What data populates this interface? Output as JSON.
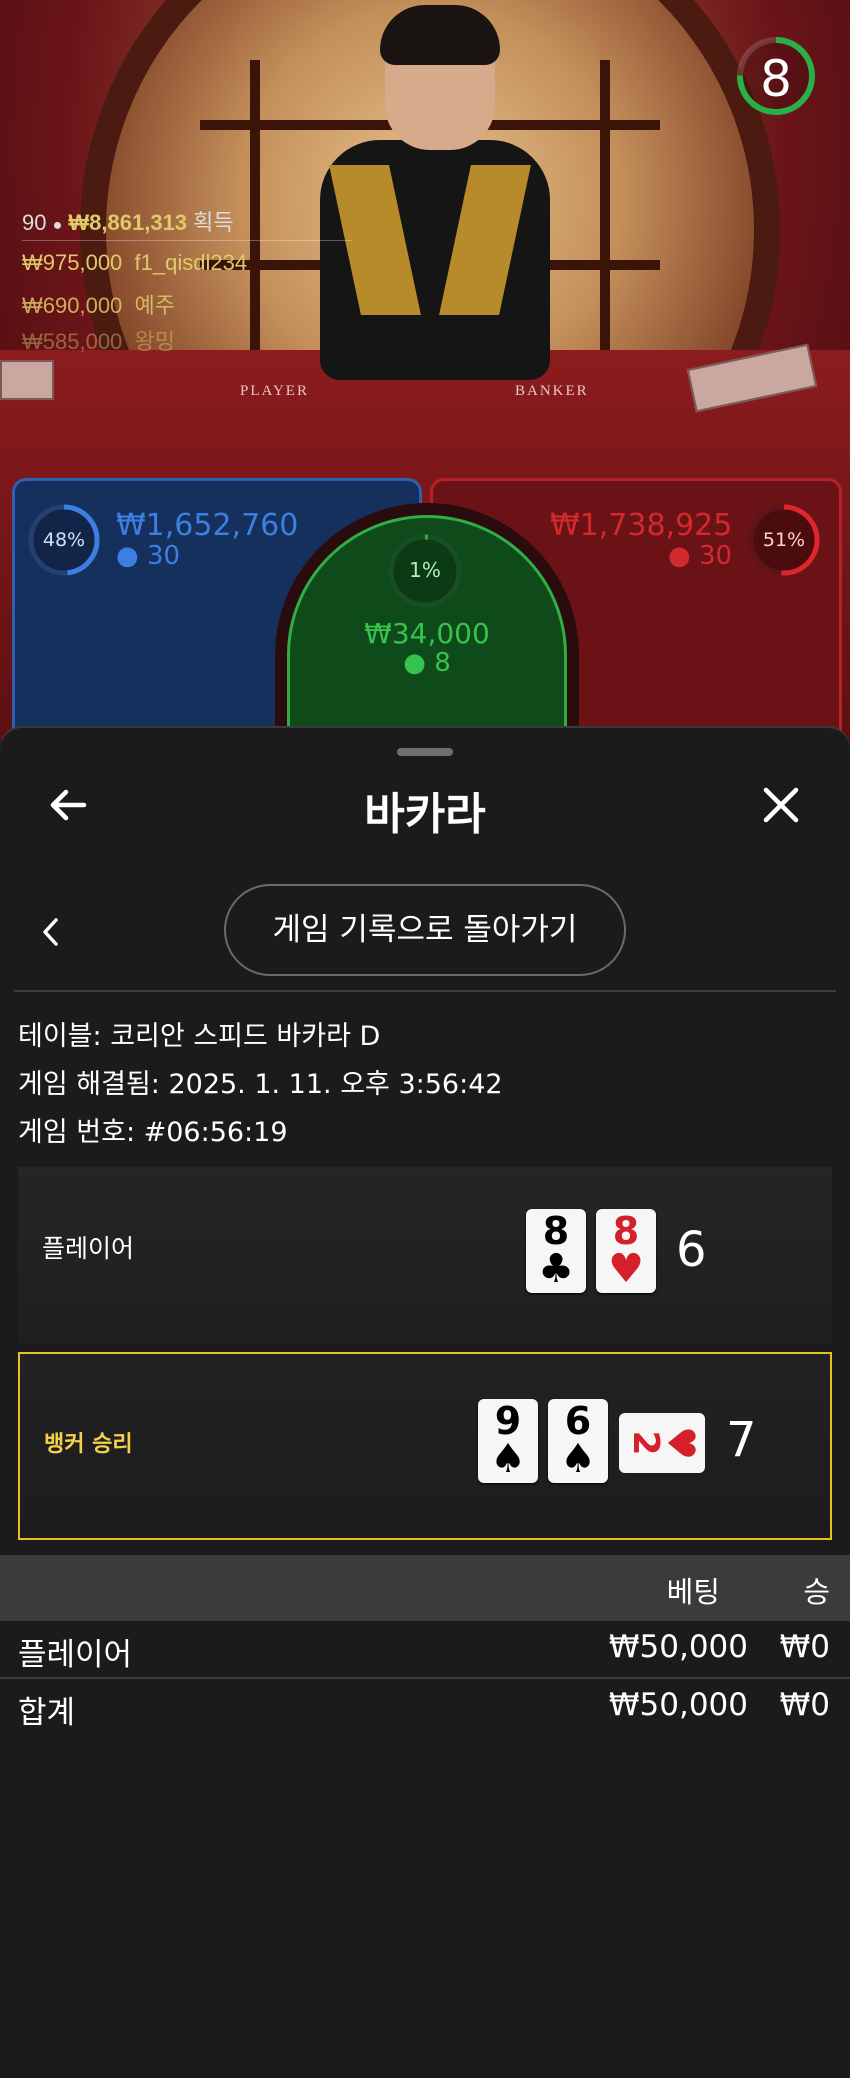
{
  "timer": {
    "value": "8"
  },
  "leaderboard": {
    "players_count": "90",
    "total_win": "₩8,861,313",
    "win_label": "획득",
    "rows": [
      {
        "amount": "₩975,000",
        "name": "f1_qisdl234"
      },
      {
        "amount": "₩690,000",
        "name": "예주"
      },
      {
        "amount": "₩585,000",
        "name": "왕밍"
      }
    ]
  },
  "table_labels": {
    "player": "PLAYER",
    "banker": "BANKER"
  },
  "bets": {
    "player": {
      "percent": "48%",
      "amount": "₩1,652,760",
      "users": "30"
    },
    "banker": {
      "percent": "51%",
      "amount": "₩1,738,925",
      "users": "30"
    },
    "tie": {
      "percent": "1%",
      "amount": "₩34,000",
      "users": "8"
    }
  },
  "panel": {
    "title": "바카라",
    "history_button": "게임 기록으로 돌아가기",
    "info": [
      "테이블: 코리안 스피드 바카라 D",
      "게임 해결됨: 2025. 1. 11. 오후 3:56:42",
      "게임 번호: #06:56:19"
    ]
  },
  "hands": {
    "player": {
      "label": "플레이어",
      "score": "6",
      "cards": [
        {
          "rank": "8",
          "suit": "♣",
          "color": "#000000"
        },
        {
          "rank": "8",
          "suit": "♥",
          "color": "#d3202a"
        }
      ]
    },
    "banker": {
      "label": "뱅커 승리",
      "score": "7",
      "cards": [
        {
          "rank": "9",
          "suit": "♠",
          "color": "#000000"
        },
        {
          "rank": "6",
          "suit": "♠",
          "color": "#000000"
        },
        {
          "rank": "2",
          "suit": "♥",
          "color": "#d3202a"
        }
      ]
    }
  },
  "bet_table": {
    "headers": {
      "bet": "베팅",
      "win": "승"
    },
    "rows": [
      {
        "name": "플레이어",
        "bet": "₩50,000",
        "win": "₩0"
      }
    ],
    "total": {
      "name": "합계",
      "bet": "₩50,000",
      "win": "₩0"
    }
  },
  "colors": {
    "gold": "#f2d14b",
    "player_blue": "#2f6cc8",
    "banker_red": "#d02a30",
    "tie_green": "#2fae43"
  }
}
